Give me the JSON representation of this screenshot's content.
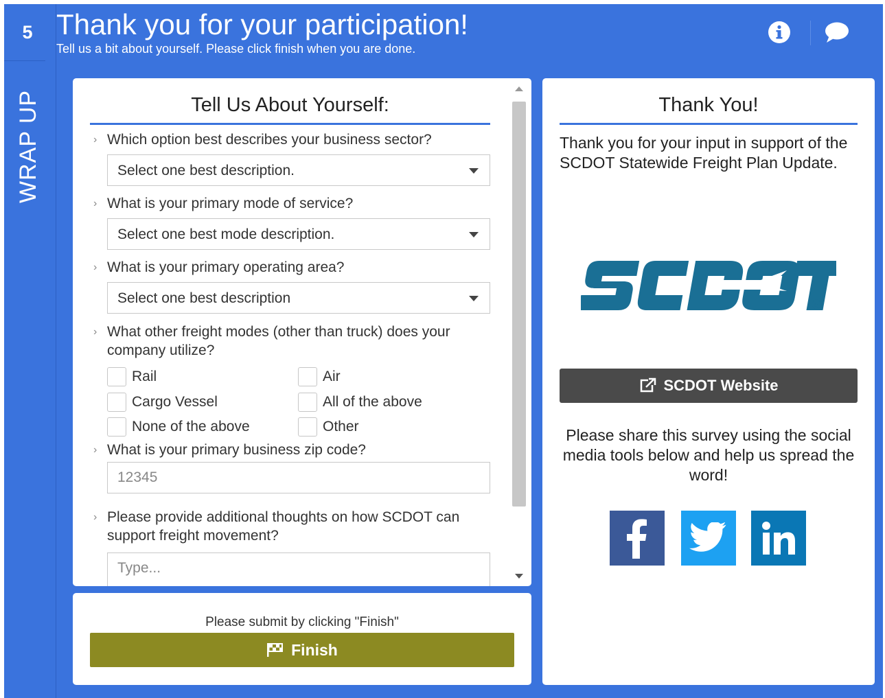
{
  "rail": {
    "step_number": "5",
    "label": "WRAP UP"
  },
  "header": {
    "title": "Thank you for your participation!",
    "subtitle": "Tell us a bit about yourself. Please click finish when you are done.",
    "info_icon": "info-icon",
    "chat_icon": "chat-icon"
  },
  "form": {
    "title": "Tell Us About Yourself:",
    "q_sector": "Which option best describes your business sector?",
    "sector_value": "Select one best description.",
    "q_mode": "What is your primary mode of service?",
    "mode_value": "Select one best mode description.",
    "q_area": "What is your primary operating area?",
    "area_value": "Select one best description",
    "q_other_modes": "What other freight modes (other than truck) does your company utilize?",
    "options": {
      "rail": "Rail",
      "air": "Air",
      "cargo_vessel": "Cargo Vessel",
      "all": "All of the above",
      "none": "None of the above",
      "other": "Other"
    },
    "q_zip": "What is your primary business zip code?",
    "zip_placeholder": "12345",
    "q_thoughts": "Please provide additional thoughts on how SCDOT can support freight movement?",
    "thoughts_placeholder": "Type..."
  },
  "submit": {
    "instruction": "Please submit by clicking \"Finish\"",
    "finish_label": "Finish"
  },
  "thanks": {
    "title": "Thank You!",
    "message": "Thank you for your input in support of the SCDOT Statewide Freight Plan Update.",
    "logo_text": "SCDOT",
    "website_label": "SCDOT Website",
    "share_text": "Please share this survey using the social media tools below and help us spread the word!"
  },
  "colors": {
    "brand_blue": "#3a73dd",
    "finish_olive": "#8c8a22",
    "scdot_teal": "#1a6f95",
    "facebook": "#3b5998",
    "twitter": "#1da1f2",
    "linkedin": "#0a77b5"
  }
}
